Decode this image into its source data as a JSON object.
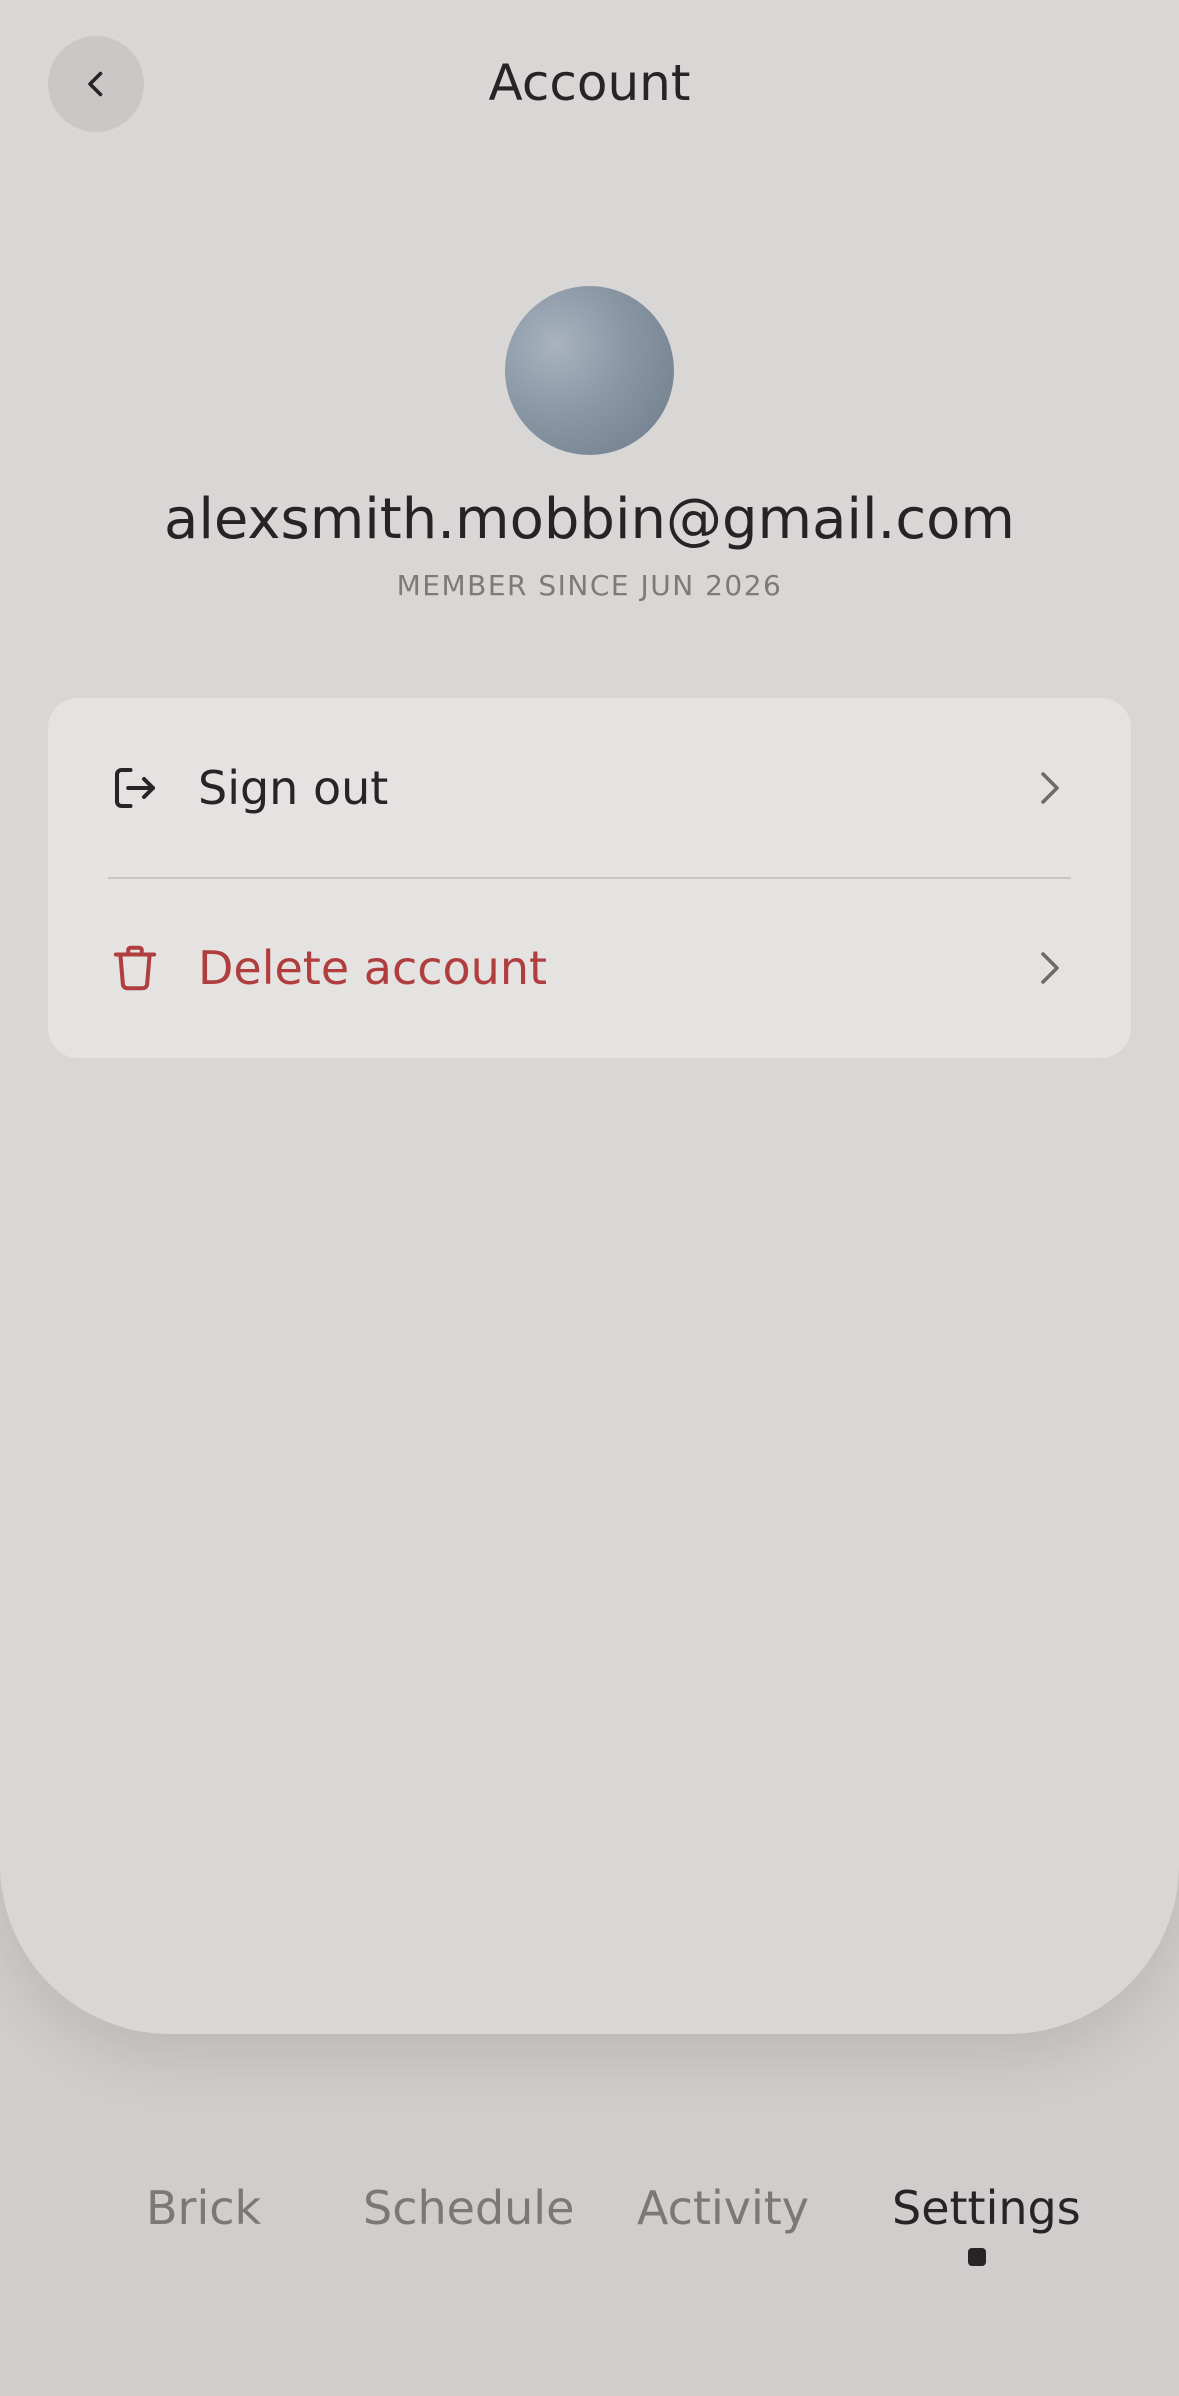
{
  "header": {
    "title": "Account",
    "back_icon": "chevron-left-icon"
  },
  "profile": {
    "email": "alexsmith.mobbin@gmail.com",
    "member_since": "MEMBER SINCE JUN 2026",
    "avatar_colors": [
      "#a8b3bf",
      "#8996a3",
      "#6d7c8b"
    ]
  },
  "menu": {
    "items": [
      {
        "label": "Sign out",
        "icon": "sign-out-icon",
        "color": "#262424"
      },
      {
        "label": "Delete account",
        "icon": "trash-icon",
        "color": "#b03e3e"
      }
    ],
    "chevron_icon": "chevron-right-icon"
  },
  "tabbar": {
    "tabs": [
      {
        "label": "Brick",
        "active": false
      },
      {
        "label": "Schedule",
        "active": false
      },
      {
        "label": "Activity",
        "active": false
      },
      {
        "label": "Settings",
        "active": true
      }
    ]
  },
  "colors": {
    "background": "#d1cdcd",
    "sheet": "#d9d6d6",
    "card": "#e5e2e2",
    "text": "#262424",
    "muted": "#7c7878",
    "danger": "#b03e3e"
  }
}
